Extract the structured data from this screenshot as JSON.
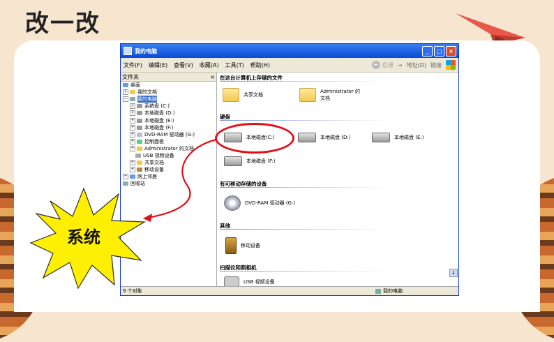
{
  "slide": {
    "title": "改一改",
    "callout": "系统"
  },
  "colors": {
    "background": "#f7e6cf",
    "accent_red": "#e0101a",
    "burst_yellow": "#ffef00",
    "titlebar_blue": "#0a4ad6"
  },
  "window": {
    "title": "我的电脑",
    "menus": [
      "文件(F)",
      "编辑(E)",
      "查看(V)",
      "收藏(A)",
      "工具(T)",
      "帮助(H)"
    ],
    "back_label": "后退",
    "address_label": "地址(D)",
    "links_label": "链接",
    "folder_pane": {
      "title": "文件夹",
      "items": [
        "桌面",
        "我的文档",
        "我的电脑",
        "系统盘 (C:)",
        "本地磁盘 (D:)",
        "本地磁盘 (E:)",
        "本地磁盘 (F:)",
        "DVD-RAM 驱动器 (G:)",
        "控制面板",
        "Administrator 的文档",
        "USB 视频设备",
        "共享文档",
        "移动设备",
        "网上邻居",
        "回收站"
      ]
    },
    "sections": {
      "shared": "在这台计算机上存储的文件",
      "hard_disk": "硬盘",
      "removable": "有可移动存储的设备",
      "other": "其他",
      "scanners": "扫描仪和照相机"
    },
    "items": {
      "shared_docs": "共享文档",
      "admin_docs": "Administrator 的文档",
      "disk_c": "本地磁盘(C:)",
      "disk_d": "本地磁盘 (D:)",
      "disk_e": "本地磁盘 (E:)",
      "disk_f": "本地磁盘 (F:)",
      "dvd": "DVD-RAM 驱动器 (G:)",
      "mobile": "移动设备",
      "usb": "USB 视频设备"
    },
    "status": {
      "count": "9 个对象",
      "location": "我的电脑"
    }
  }
}
